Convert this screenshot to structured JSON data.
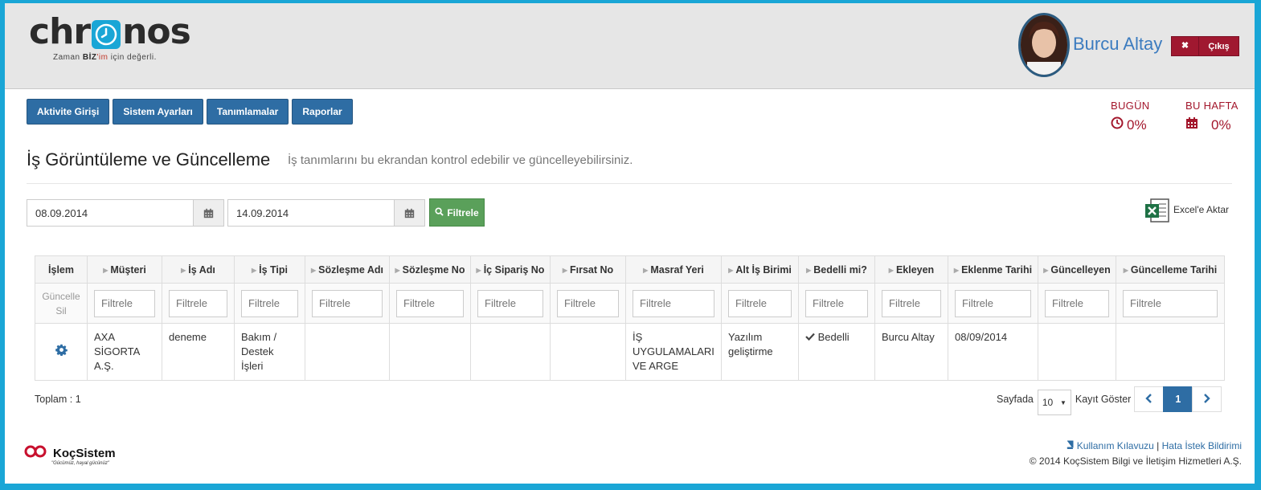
{
  "header": {
    "brand_word_left": "chr",
    "brand_word_right": "nos",
    "brand_tag_pre": "Zaman ",
    "brand_tag_biz": "BİZ",
    "brand_tag_im": "'im",
    "brand_tag_post": " için değerli.",
    "user_name": "Burcu Altay",
    "logout_icon": "✖",
    "logout_label": "Çıkış"
  },
  "nav": {
    "items": [
      "Aktivite Girişi",
      "Sistem Ayarları",
      "Tanımlamalar",
      "Raporlar"
    ]
  },
  "stats": {
    "today_label": "BUGÜN",
    "today_value": "0%",
    "week_label": "BU HAFTA",
    "week_value": "0%"
  },
  "page": {
    "title": "İş Görüntüleme ve Güncelleme",
    "description": "İş tanımlarını bu ekrandan kontrol edebilir ve güncelleyebilirsiniz."
  },
  "filters": {
    "start_date": "08.09.2014",
    "end_date": "14.09.2014",
    "filter_button": "Filtrele",
    "excel_label": "Excel'e Aktar"
  },
  "grid": {
    "columns": [
      "İşlem",
      "Müşteri",
      "İş Adı",
      "İş Tipi",
      "Sözleşme Adı",
      "Sözleşme No",
      "İç Sipariş No",
      "Fırsat No",
      "Masraf Yeri",
      "Alt İş Birimi",
      "Bedelli mi?",
      "Ekleyen",
      "Eklenme Tarihi",
      "Güncelleyen",
      "Güncelleme Tarihi"
    ],
    "action_update": "Güncelle",
    "action_delete": "Sil",
    "filter_placeholder": "Filtrele",
    "rows": [
      {
        "customer": "AXA SİGORTA A.Ş.",
        "job_name": "deneme",
        "job_type": "Bakım / Destek İşleri",
        "contract_name": "",
        "contract_no": "",
        "internal_order_no": "",
        "opportunity_no": "",
        "cost_center": "İŞ UYGULAMALARI VE ARGE",
        "sub_unit": "Yazılım geliştirme",
        "billable": "Bedelli",
        "added_by": "Burcu Altay",
        "added_date": "08/09/2014",
        "updated_by": "",
        "updated_date": ""
      }
    ]
  },
  "footer": {
    "total_label": "Toplam : 1",
    "per_page_label": "Sayfada",
    "per_page_value": "10",
    "show_records_label": "Kayıt Göster",
    "current_page": "1",
    "company_name": "KoçSistem",
    "company_slogan": "\"Gücümüz, hayal gücünüz\"",
    "guide_link": "Kullanım Kılavuzu",
    "separator": "|",
    "bug_link": "Hata İstek Bildirimi",
    "copyright": "© 2014 KoçSistem Bilgi ve İletişim Hizmetleri A.Ş."
  },
  "colors": {
    "primary": "#2e6da4",
    "danger": "#a01830",
    "success": "#5aa05a",
    "accent": "#1aa6d6",
    "stat_red": "#a3172c"
  },
  "icons": {
    "logout": "close-icon",
    "today": "clock-icon",
    "week": "calendar-icon",
    "date_picker": "calendar-icon",
    "filter": "search-icon",
    "excel": "excel-icon",
    "row_action": "gear-icon",
    "billable": "check-icon",
    "guide": "book-icon",
    "prev": "chevron-left-icon",
    "next": "chevron-right-icon"
  }
}
